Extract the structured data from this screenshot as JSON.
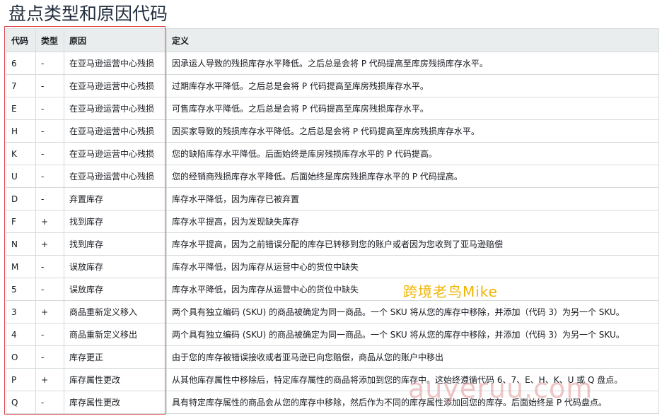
{
  "title": "盘点类型和原因代码",
  "table": {
    "headers": [
      "代码",
      "类型",
      "原因",
      "定义"
    ],
    "rows": [
      {
        "code": "6",
        "type": "-",
        "reason": "在亚马逊运营中心残损",
        "definition": "因承运人导致的残损库存水平降低。之后总是会将 P 代码提高至库房残损库存水平。"
      },
      {
        "code": "7",
        "type": "-",
        "reason": "在亚马逊运营中心残损",
        "definition": "过期库存水平降低。之后总是会将 P 代码提高至库房残损库存水平。"
      },
      {
        "code": "E",
        "type": "-",
        "reason": "在亚马逊运营中心残损",
        "definition": "可售库存水平降低。之后总是会将 P 代码提高至库房残损库存水平。"
      },
      {
        "code": "H",
        "type": "-",
        "reason": "在亚马逊运营中心残损",
        "definition": "因买家导致的残损库存水平降低。之后总是会将 P 代码提高至库房残损库存水平。"
      },
      {
        "code": "K",
        "type": "-",
        "reason": "在亚马逊运营中心残损",
        "definition": "您的缺陷库存水平降低。后面始终是库房残损库存水平的 P 代码提高。"
      },
      {
        "code": "U",
        "type": "-",
        "reason": "在亚马逊运营中心残损",
        "definition": "您的经销商残损库存水平降低。后面始终是库房残损库存水平的 P 代码提高。"
      },
      {
        "code": "D",
        "type": "-",
        "reason": "弃置库存",
        "definition": "库存水平降低，因为库存已被弃置"
      },
      {
        "code": "F",
        "type": "+",
        "reason": "找到库存",
        "definition": "库存水平提高，因为发现缺失库存"
      },
      {
        "code": "N",
        "type": "+",
        "reason": "找到库存",
        "definition": "库存水平提高，因为之前错误分配的库存已转移到您的账户或者因为您收到了亚马逊赔偿"
      },
      {
        "code": "M",
        "type": "-",
        "reason": "误放库存",
        "definition": "库存水平降低，因为库存从运营中心的货位中缺失"
      },
      {
        "code": "5",
        "type": "-",
        "reason": "误放库存",
        "definition": "库存水平降低，因为库存从运营中心的货位中缺失"
      },
      {
        "code": "3",
        "type": "+",
        "reason": "商品重新定义移入",
        "definition": "两个具有独立编码 (SKU) 的商品被确定为同一商品。一个 SKU 将从您的库存中移除，并添加（代码 3）为另一个 SKU。"
      },
      {
        "code": "4",
        "type": "-",
        "reason": "商品重新定义移出",
        "definition": "两个具有独立编码 (SKU) 的商品被确定为同一商品。一个 SKU 将从您的库存中移除，并添加（代码 3）为另一个 SKU。"
      },
      {
        "code": "O",
        "type": "-",
        "reason": "库存更正",
        "definition": "由于您的库存被错误接收或者亚马逊已向您赔偿，商品从您的账户中移出"
      },
      {
        "code": "P",
        "type": "+",
        "reason": "库存属性更改",
        "definition": "从其他库存属性中移除后，特定库存属性的商品将添加到您的库存中。这始终遵循代码 6、7、E、H、K、U 或 Q 盘点。"
      },
      {
        "code": "Q",
        "type": "-",
        "reason": "库存属性更改",
        "definition": "具有特定库存属性的商品会从您的库存中移除，然后作为不同的库存属性添加回您的库存。后面始终是 P 代码盘点。"
      }
    ]
  },
  "watermark": {
    "text": "跨境老鸟Mike",
    "url": "auyeruu.com"
  },
  "colors": {
    "header_bg": "#eaeded",
    "border": "#d5dbdb",
    "highlight_box": "#e0474c",
    "watermark_text": "#f0b400"
  }
}
